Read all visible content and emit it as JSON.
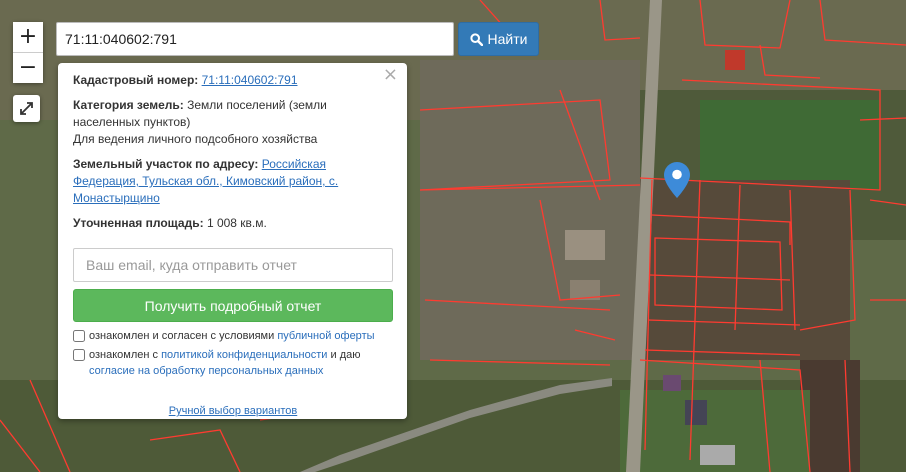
{
  "search": {
    "value": "71:11:040602:791",
    "button_label": "Найти"
  },
  "zoom": {
    "in_label": "+",
    "out_label": "−"
  },
  "panel": {
    "close_label": "×",
    "cadastral": {
      "label": "Кадастровый номер:",
      "value": "71:11:040602:791"
    },
    "category": {
      "label": "Категория земель:",
      "value": "Земли поселений (земли населенных пунктов)",
      "use": "Для ведения личного подсобного хозяйства"
    },
    "address": {
      "label": "Земельный участок по адресу:",
      "value": "Российская Федерация, Тульская обл., Кимовский район, с. Монастырщино"
    },
    "area": {
      "label": "Уточненная площадь:",
      "value": "1 008 кв.м."
    },
    "email_placeholder": "Ваш email, куда отправить отчет",
    "report_button": "Получить подробный отчет",
    "check1": {
      "text": "ознакомлен и согласен с условиями",
      "link": "публичной оферты"
    },
    "check2": {
      "text": "ознакомлен с",
      "link": "политикой конфиденциальности",
      "text2": "и даю",
      "link2": "согласие на обработку персональных данных"
    },
    "manual_link": "Ручной выбор вариантов"
  },
  "colors": {
    "primary": "#337ab7",
    "success": "#5cb85c",
    "parcel": "#ff3b30",
    "marker": "#3d8bd9"
  }
}
